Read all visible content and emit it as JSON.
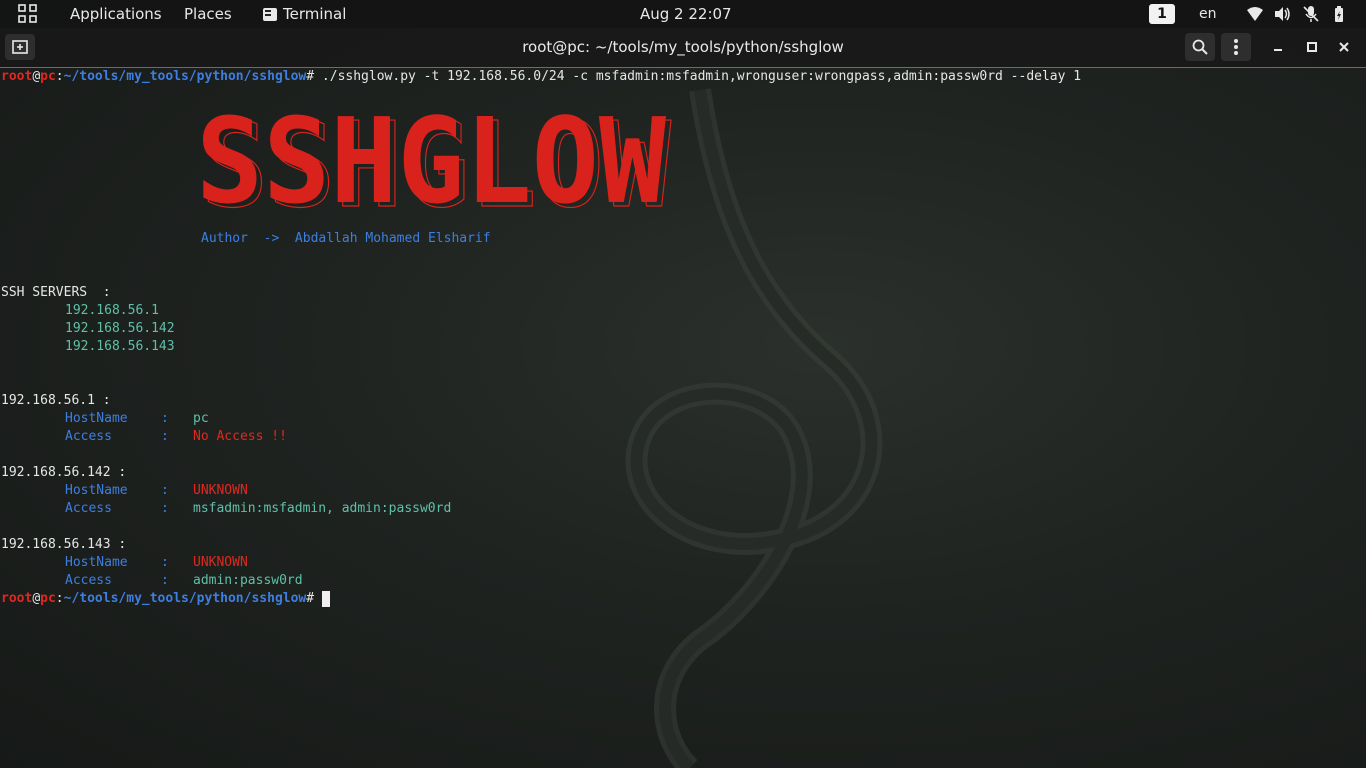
{
  "top_panel": {
    "applications": "Applications",
    "places": "Places",
    "terminal": "Terminal",
    "clock": "Aug 2  22:07",
    "workspace": "1",
    "language": "en"
  },
  "window": {
    "title": "root@pc: ~/tools/my_tools/python/sshglow"
  },
  "terminal": {
    "prompt_user": "root",
    "prompt_at": "@",
    "prompt_host": "pc",
    "prompt_colon": ":",
    "prompt_path": "~/tools/my_tools/python/sshglow",
    "prompt_hash": "# ",
    "command": "./sshglow.py -t 192.168.56.0/24 -c msfadmin:msfadmin,wronguser:wrongpass,admin:passw0rd --delay 1",
    "banner_text": "SSHGLOW",
    "author_label": "Author  ->  ",
    "author_name": "Abdallah Mohamed Elsharif",
    "servers_header": "SSH SERVERS  :",
    "servers": [
      "192.168.56.1",
      "192.168.56.142",
      "192.168.56.143"
    ],
    "hostname_label": "HostName",
    "access_label": "Access",
    "sep": ":",
    "hosts": [
      {
        "ip_line": "192.168.56.1 :",
        "hostname": "pc",
        "access": "No Access !!"
      },
      {
        "ip_line": "192.168.56.142 :",
        "hostname": "UNKNOWN",
        "access": "msfadmin:msfadmin, admin:passw0rd"
      },
      {
        "ip_line": "192.168.56.143 :",
        "hostname": "UNKNOWN",
        "access": "admin:passw0rd"
      }
    ]
  },
  "colors": {
    "prompt_red": "#e0281f",
    "path_blue": "#3d7fe0",
    "value_teal": "#5fc0a8",
    "banner_red": "#d9221c",
    "accent_line": "#3a6fd8"
  },
  "icons": {
    "apps": "apps-grid-icon",
    "terminal": "terminal-icon",
    "network": "wifi-icon",
    "volume": "volume-icon",
    "mic": "mic-muted-icon",
    "battery": "battery-icon",
    "new_tab": "new-tab-icon",
    "search": "search-icon",
    "menu": "kebab-menu-icon",
    "minimize": "minimize-icon",
    "maximize": "maximize-icon",
    "close": "close-icon"
  }
}
